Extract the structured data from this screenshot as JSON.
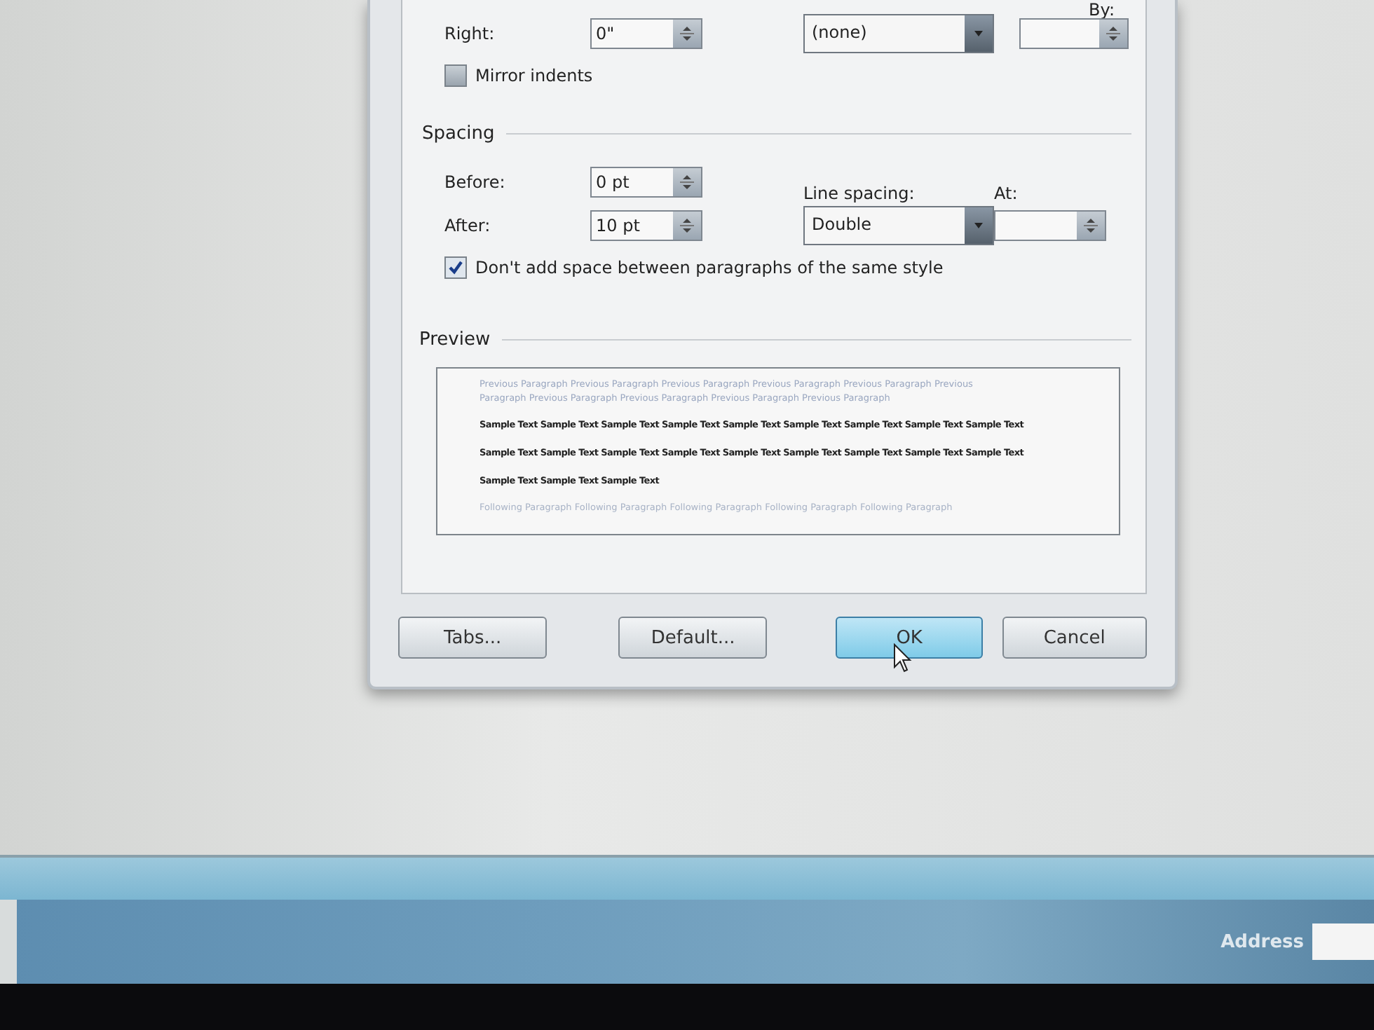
{
  "indentation": {
    "right_label": "Right:",
    "right_value": "0\"",
    "special_value": "(none)",
    "by_label": "By:",
    "mirror_indents": {
      "label": "Mirror indents",
      "checked": false
    }
  },
  "spacing": {
    "title": "Spacing",
    "before_label": "Before:",
    "before_value": "0 pt",
    "after_label": "After:",
    "after_value": "10 pt",
    "line_spacing_label": "Line spacing:",
    "line_spacing_value": "Double",
    "at_label": "At:",
    "no_space_same_style": {
      "label": "Don't add space between paragraphs of the same style",
      "checked": true
    }
  },
  "preview": {
    "title": "Preview",
    "lines": [
      {
        "kind": "previous",
        "text": "Previous Paragraph Previous Paragraph Previous Paragraph Previous Paragraph Previous Paragraph Previous"
      },
      {
        "kind": "previous",
        "text": "Paragraph Previous Paragraph Previous Paragraph Previous Paragraph Previous Paragraph"
      },
      {
        "kind": "sample",
        "text": "Sample Text Sample Text Sample Text Sample Text Sample Text Sample Text Sample Text Sample Text Sample Text"
      },
      {
        "kind": "sample",
        "text": "Sample Text Sample Text Sample Text Sample Text Sample Text Sample Text Sample Text Sample Text Sample Text"
      },
      {
        "kind": "sample",
        "text": "Sample Text Sample Text Sample Text"
      },
      {
        "kind": "following",
        "text": "Following Paragraph Following Paragraph Following Paragraph Following Paragraph Following Paragraph"
      }
    ]
  },
  "buttons": [
    {
      "label": "Tabs...",
      "default": false
    },
    {
      "label": "Default...",
      "default": false
    },
    {
      "label": "OK",
      "default": true
    },
    {
      "label": "Cancel",
      "default": false
    }
  ],
  "taskbar": {
    "address_label": "Address"
  }
}
